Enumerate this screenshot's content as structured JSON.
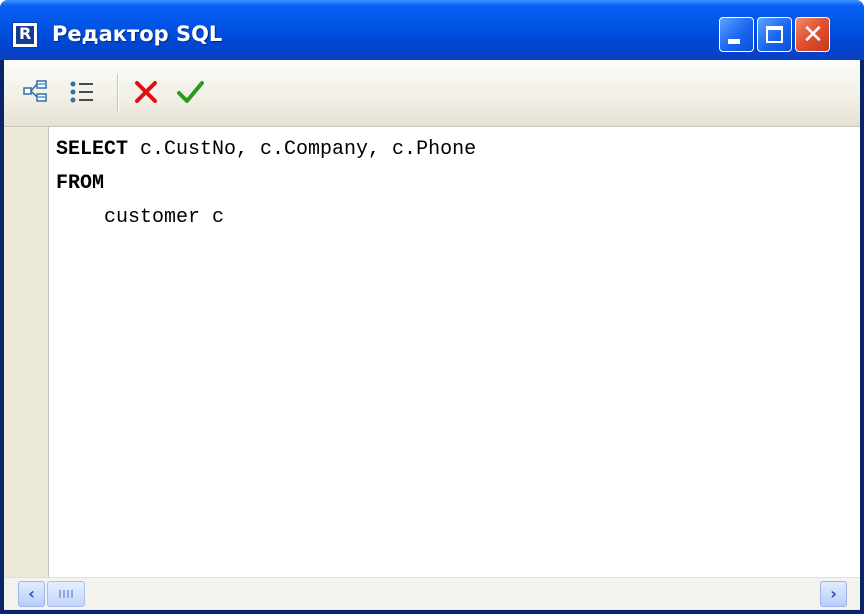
{
  "window": {
    "title": "Редактор SQL",
    "controls": {
      "minimize": "minimize-icon",
      "maximize": "maximize-icon",
      "close": "close-icon"
    }
  },
  "toolbar": {
    "buttons": [
      {
        "name": "query-builder",
        "icon": "diagram-icon"
      },
      {
        "name": "params",
        "icon": "list-icon"
      },
      {
        "name": "cancel",
        "icon": "cross-icon",
        "color": "#e01010"
      },
      {
        "name": "ok",
        "icon": "checkmark-icon",
        "color": "#2a9a1a"
      }
    ]
  },
  "editor": {
    "lines": [
      {
        "kw": "SELECT",
        "rest": " c.CustNo, c.Company, c.Phone"
      },
      {
        "kw": "FROM",
        "rest": ""
      },
      {
        "kw": "",
        "rest": "    customer c"
      }
    ]
  },
  "scrollbar": {
    "left_icon": "arrow-left-icon",
    "right_icon": "arrow-right-icon"
  }
}
